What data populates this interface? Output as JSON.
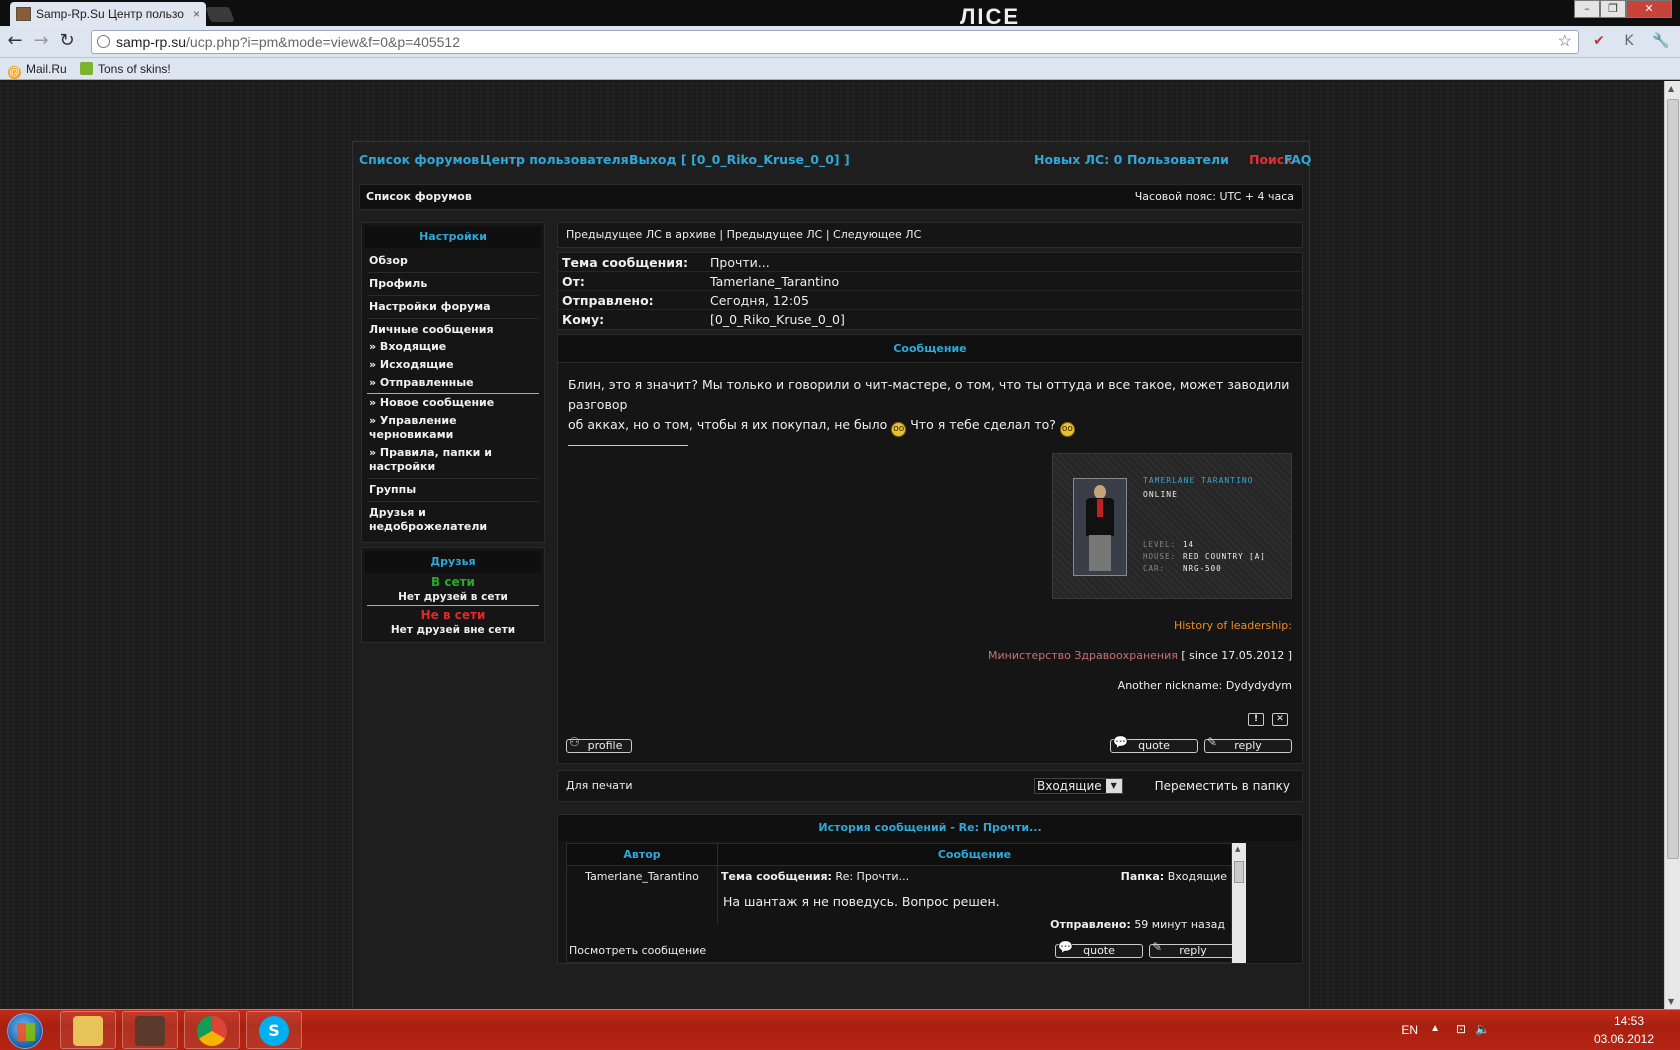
{
  "browser": {
    "tab_title": "Samp-Rp.Su Центр пользо",
    "tab_close": "×",
    "url_host": "samp-rp.su",
    "url_path": "/ucp.php?i=pm&mode=view&f=0&p=405512",
    "bookmarks": [
      {
        "label": "Mail.Ru",
        "icon": "mailru-icon"
      },
      {
        "label": "Tons of skins!",
        "icon": "speech-bubble-icon"
      }
    ],
    "logo": "ЛICE"
  },
  "topnav": {
    "forums": "Список форумов",
    "ucp": "Центр пользователя",
    "logout": "Выход [ [0_0_Riko_Kruse_0_0] ]",
    "new_pm": "Новых ЛС: 0",
    "users": "Пользователи",
    "search": "Поиск",
    "faq": "FAQ"
  },
  "navbar": {
    "breadcrumb": "Список форумов",
    "timezone": "Часовой пояс: UTC + 4 часа"
  },
  "sidebar": {
    "settings_title": "Настройки",
    "items": [
      {
        "label": "Обзор"
      },
      {
        "label": "Профиль"
      },
      {
        "label": "Настройки форума"
      },
      {
        "label": "Личные сообщения"
      }
    ],
    "pm_sub": [
      {
        "label": "» Входящие"
      },
      {
        "label": "» Исходящие"
      },
      {
        "label": "» Отправленные"
      },
      {
        "label": "» Новое сообщение"
      },
      {
        "label": "» Управление черновиками"
      },
      {
        "label": "» Правила, папки и настройки"
      }
    ],
    "groups": "Группы",
    "friends_foes": "Друзья и недоброжелатели",
    "friends_title": "Друзья",
    "online_label": "В сети",
    "online_empty": "Нет друзей в сети",
    "offline_label": "Не в сети",
    "offline_empty": "Нет друзей вне сети"
  },
  "pm": {
    "nav": "Предыдущее ЛС в архиве | Предыдущее ЛС | Следующее ЛС",
    "subject_label": "Тема сообщения:",
    "subject": "Прочти...",
    "from_label": "От:",
    "from": "Tamerlane_Tarantino",
    "sent_label": "Отправлено:",
    "sent": "Сегодня, 12:05",
    "to_label": "Кому:",
    "to": "[0_0_Riko_Kruse_0_0]",
    "message_header": "Сообщение",
    "body_line1": "Блин, это я значит? Мы только и говорили о чит-мастере, о том, что ты оттуда и все такое, может заводили разговор",
    "body_line2a": "об акках, но о том, чтобы я их покупал, не было",
    "body_line2b": "Что я тебе сделал то?"
  },
  "player_card": {
    "name": "Tamerlane Tarantino",
    "status": "Online",
    "level_label": "Level:",
    "level": "14",
    "house_label": "House:",
    "house": "Red Country [A]",
    "car_label": "Car:",
    "car": "NRG-500"
  },
  "signature": {
    "history": "History of leadership:",
    "ministry": "Министерство Здравоохранения",
    "since": "[ since 17.05.2012 ]",
    "another_nick": "Another nickname: Dydydydym"
  },
  "buttons": {
    "report": "!",
    "delete": "✕",
    "profile": "profile",
    "quote": "quote",
    "reply": "reply"
  },
  "printbar": {
    "print": "Для печати",
    "folder": "Входящие",
    "move": "Переместить в папку"
  },
  "history": {
    "title": "История сообщений - Re: Прочти...",
    "col_author": "Автор",
    "col_message": "Сообщение",
    "author": "Tamerlane_Tarantino",
    "subject_label": "Тема сообщения:",
    "subject": "Re: Прочти...",
    "folder_label": "Папка:",
    "folder": "Входящие",
    "text": "На шантаж я не поведусь. Вопрос решен.",
    "sent_label": "Отправлено:",
    "sent": "59 минут назад",
    "view": "Посмотреть сообщение"
  },
  "taskbar": {
    "lang": "EN",
    "time": "14:53",
    "date": "03.06.2012"
  }
}
